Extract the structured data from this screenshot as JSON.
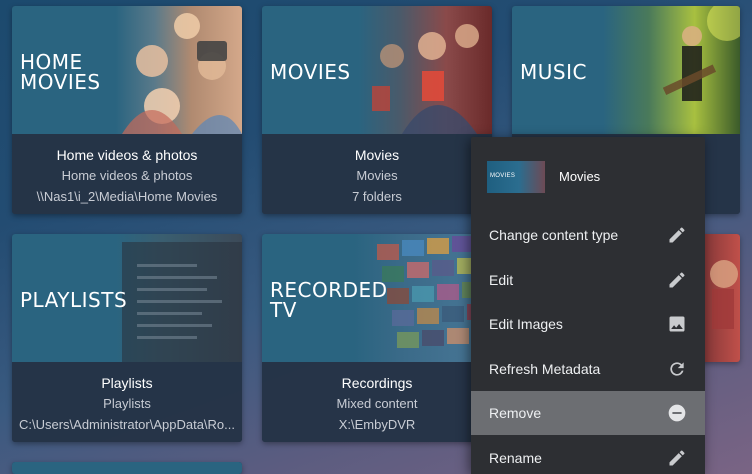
{
  "library": {
    "cards": [
      {
        "tile_text": "HOME\nMOVIES",
        "name": "Home videos & photos",
        "type": "Home videos & photos",
        "path": "\\\\Nas1\\i_2\\Media\\Home Movies"
      },
      {
        "tile_text": "MOVIES",
        "name": "Movies",
        "type": "Movies",
        "path": "7 folders"
      },
      {
        "tile_text": "MUSIC"
      },
      {
        "tile_text": "PLAYLISTS",
        "name": "Playlists",
        "type": "Playlists",
        "path": "C:\\Users\\Administrator\\AppData\\Ro..."
      },
      {
        "tile_text": "RECORDED\nTV",
        "name": "Recordings",
        "type": "Mixed content",
        "path": "X:\\EmbyDVR"
      }
    ]
  },
  "context_menu": {
    "header_thumb_text": "MOVIES",
    "header_title": "Movies",
    "items": [
      {
        "label": "Change content type",
        "icon": "pencil-icon"
      },
      {
        "label": "Edit",
        "icon": "pencil-icon"
      },
      {
        "label": "Edit Images",
        "icon": "image-icon"
      },
      {
        "label": "Refresh Metadata",
        "icon": "refresh-icon"
      },
      {
        "label": "Remove",
        "icon": "remove-circle-icon",
        "highlighted": true
      },
      {
        "label": "Rename",
        "icon": "pencil-icon"
      }
    ]
  },
  "colors": {
    "tile_teal": "#2a6480",
    "menu_bg": "#2d2f33",
    "menu_highlight": "#6c6e72"
  }
}
